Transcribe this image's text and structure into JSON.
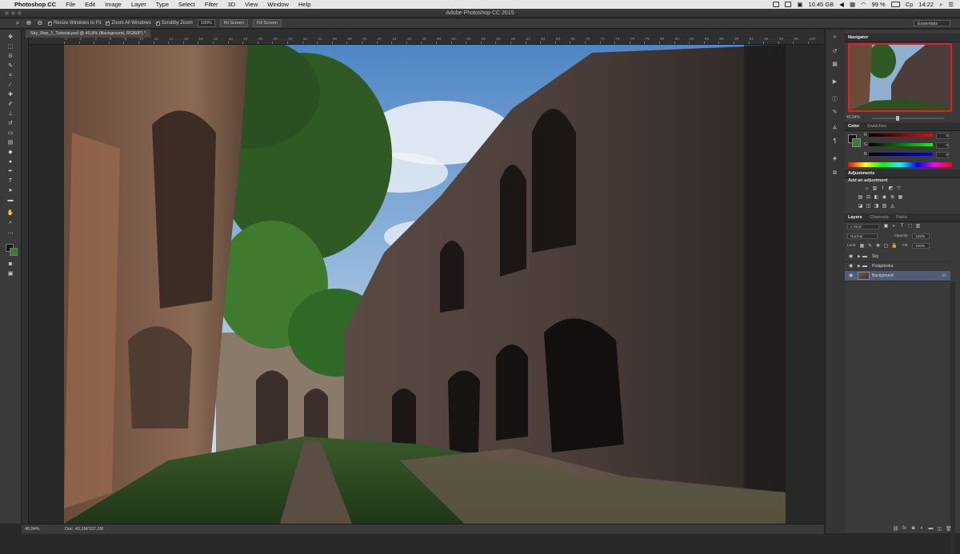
{
  "menubar": {
    "app": "Photoshop CC",
    "items": [
      "File",
      "Edit",
      "Image",
      "Layer",
      "Type",
      "Select",
      "Filter",
      "3D",
      "View",
      "Window",
      "Help"
    ],
    "storage": "10.45 GB",
    "battery": "99 %",
    "day": "Ср",
    "clock": "14:22"
  },
  "window": {
    "title": "Adobe Photoshop CC 2015"
  },
  "options": {
    "resize_windows": "Resize Windows to Fit",
    "zoom_all": "Zoom All Windows",
    "scrubby": "Scrubby Zoom",
    "zoom_value": "100%",
    "fit_screen": "Fit Screen",
    "fill_screen": "Fill Screen",
    "workspace": "Essentials"
  },
  "document": {
    "tab": "Sky_Rep_1_Tutorial.psd @ 40,9% (Background, RGB/8*) *"
  },
  "ruler": {
    "h_ticks": [
      "0",
      "2",
      "4",
      "6",
      "8",
      "10",
      "12",
      "14",
      "16",
      "18",
      "20",
      "22",
      "24",
      "26",
      "28",
      "30",
      "32",
      "34",
      "36",
      "38",
      "40",
      "42",
      "44",
      "46",
      "48",
      "50",
      "52",
      "54",
      "56",
      "58",
      "60",
      "62",
      "64",
      "66",
      "68",
      "70",
      "72",
      "74",
      "76",
      "78",
      "80",
      "82",
      "84",
      "86",
      "88",
      "90",
      "92",
      "94",
      "96",
      "98",
      "100",
      "102",
      "104"
    ]
  },
  "status": {
    "zoom": "40,94%",
    "doc": "Doc: 43,1M/107,1M"
  },
  "panels": {
    "navigator": {
      "title": "Navigator",
      "zoom": "40,94%"
    },
    "color": {
      "tab_active": "Color",
      "tab_other": "Swatches",
      "channels": [
        "R",
        "G",
        "B"
      ],
      "values": [
        "0",
        "0",
        "0"
      ]
    },
    "adjustments": {
      "title": "Adjustments",
      "add": "Add an adjustment"
    },
    "layers": {
      "tabs": [
        "Layers",
        "Channels",
        "Paths"
      ],
      "kind": "Kind",
      "blend": "Normal",
      "opacity_label": "Opacity:",
      "opacity": "100%",
      "lock_label": "Lock:",
      "fill_label": "Fill:",
      "fill": "100%",
      "rows": [
        {
          "name": "Sky",
          "type": "group"
        },
        {
          "name": "Podgotovka",
          "type": "group"
        },
        {
          "name": "Background",
          "type": "layer"
        }
      ]
    }
  },
  "colors": {
    "accent_red": "#e02020",
    "selected_layer": "#4f5e76",
    "bg_swatch": "#3b7a3b"
  }
}
